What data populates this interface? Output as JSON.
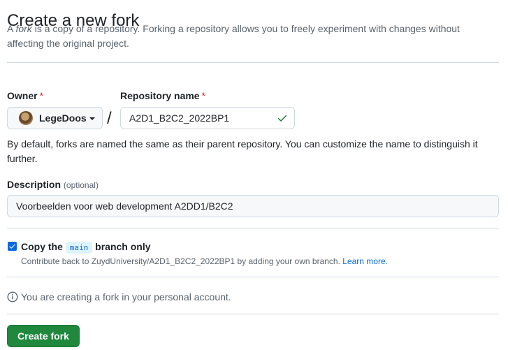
{
  "page": {
    "title": "Create a new fork",
    "intro_prefix": "A ",
    "intro_em": "fork",
    "intro_suffix": " is a copy of a repository. Forking a repository allows you to freely experiment with changes without affecting the original project."
  },
  "form": {
    "owner_label": "Owner",
    "required_mark": "*",
    "owner_value": "LegeDoos",
    "separator": "/",
    "repo_label": "Repository name",
    "repo_value": "A2D1_B2C2_2022BP1",
    "repo_valid_icon": "check-icon",
    "name_help": "By default, forks are named the same as their parent repository. You can customize the name to distinguish it further.",
    "description_label": "Description",
    "description_optional": "(optional)",
    "description_value": "Voorbeelden voor web development A2DD1/B2C2",
    "copy_branch_prefix": "Copy the",
    "copy_branch_name": "main",
    "copy_branch_suffix": "branch only",
    "copy_branch_checked": true,
    "copy_note": "Contribute back to ZuydUniversity/A2D1_B2C2_2022BP1 by adding your own branch.",
    "learn_more": "Learn more.",
    "info_text": "You are creating a fork in your personal account.",
    "submit_label": "Create fork"
  },
  "colors": {
    "primary_button": "#1f883d",
    "link": "#0969da",
    "required": "#d1242f",
    "valid": "#1a7f37"
  }
}
